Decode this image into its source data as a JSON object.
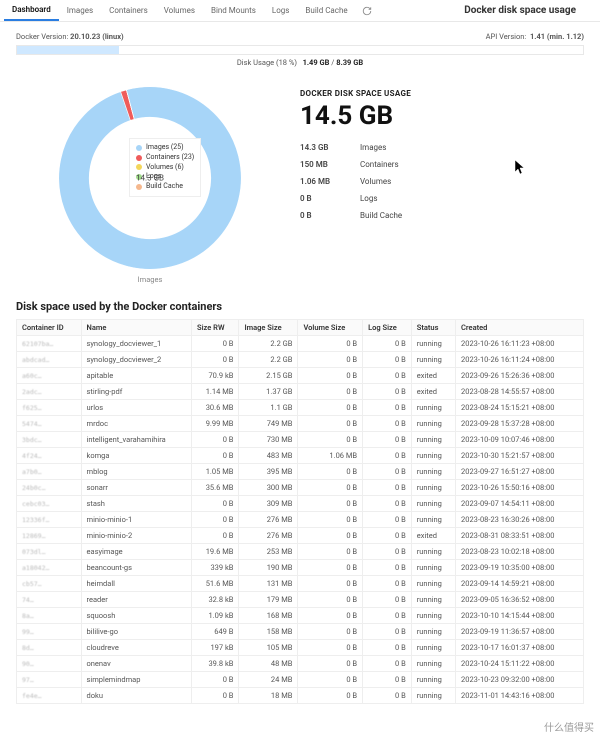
{
  "tabs": [
    "Dashboard",
    "Images",
    "Containers",
    "Volumes",
    "Bind Mounts",
    "Logs",
    "Build Cache"
  ],
  "active_tab": 0,
  "title": "Docker disk space usage",
  "docker_version_label": "Docker Version:",
  "docker_version": "20.10.23 (linux)",
  "api_version_label": "API Version:",
  "api_version": "1.41 (min. 1.12)",
  "usage_bar": {
    "percent": 18,
    "text_prefix": "Disk Usage (18 %)",
    "used": "1.49 GB",
    "total": "8.39 GB"
  },
  "colors": {
    "images": "#a7d5f8",
    "containers": "#ef5b5b",
    "volumes": "#f3d65b",
    "logs": "#9fd98a",
    "buildcache": "#f5b88e"
  },
  "legend": [
    {
      "key": "images",
      "label": "Images (25)"
    },
    {
      "key": "containers",
      "label": "Containers (23)"
    },
    {
      "key": "volumes",
      "label": "Volumes (6)"
    },
    {
      "key": "logs",
      "label": "Logs"
    },
    {
      "key": "buildcache",
      "label": "Build Cache"
    }
  ],
  "donut_center": "14.3 GB",
  "donut_caption": "Images",
  "stats_heading": "DOCKER DISK SPACE USAGE",
  "total": "14.5 GB",
  "stats": [
    {
      "val": "14.3 GB",
      "label": "Images"
    },
    {
      "val": "150 MB",
      "label": "Containers"
    },
    {
      "val": "1.06 MB",
      "label": "Volumes"
    },
    {
      "val": "0 B",
      "label": "Logs"
    },
    {
      "val": "0 B",
      "label": "Build Cache"
    }
  ],
  "table_title": "Disk space used by the Docker containers",
  "columns": [
    "Container ID",
    "Name",
    "Size RW",
    "Image Size",
    "Volume Size",
    "Log Size",
    "Status",
    "Created"
  ],
  "rows": [
    {
      "cid": "62107ba…",
      "name": "synology_docviewer_1",
      "rw": "0 B",
      "img": "2.2 GB",
      "vol": "0 B",
      "log": "0 B",
      "status": "running",
      "created": "2023-10-26 16:11:23 +08:00"
    },
    {
      "cid": "abdcad…",
      "name": "synology_docviewer_2",
      "rw": "0 B",
      "img": "2.2 GB",
      "vol": "0 B",
      "log": "0 B",
      "status": "running",
      "created": "2023-10-26 16:11:24 +08:00"
    },
    {
      "cid": "a60c…",
      "name": "apitable",
      "rw": "70.9 kB",
      "img": "2.15 GB",
      "vol": "0 B",
      "log": "0 B",
      "status": "exited",
      "created": "2023-09-26 15:26:36 +08:00"
    },
    {
      "cid": "2adc…",
      "name": "stirling-pdf",
      "rw": "1.14 MB",
      "img": "1.37 GB",
      "vol": "0 B",
      "log": "0 B",
      "status": "exited",
      "created": "2023-08-28 14:55:57 +08:00"
    },
    {
      "cid": "f625…",
      "name": "urlos",
      "rw": "30.6 MB",
      "img": "1.1 GB",
      "vol": "0 B",
      "log": "0 B",
      "status": "running",
      "created": "2023-08-24 15:15:21 +08:00"
    },
    {
      "cid": "5474…",
      "name": "mrdoc",
      "rw": "9.99 MB",
      "img": "749 MB",
      "vol": "0 B",
      "log": "0 B",
      "status": "running",
      "created": "2023-09-28 15:37:28 +08:00"
    },
    {
      "cid": "3bdc…",
      "name": "intelligent_varahamihira",
      "rw": "0 B",
      "img": "730 MB",
      "vol": "0 B",
      "log": "0 B",
      "status": "running",
      "created": "2023-10-09 10:07:46 +08:00"
    },
    {
      "cid": "4f24…",
      "name": "komga",
      "rw": "0 B",
      "img": "483 MB",
      "vol": "1.06 MB",
      "log": "0 B",
      "status": "running",
      "created": "2023-10-30 15:21:57 +08:00"
    },
    {
      "cid": "a7b0…",
      "name": "mblog",
      "rw": "1.05 MB",
      "img": "395 MB",
      "vol": "0 B",
      "log": "0 B",
      "status": "running",
      "created": "2023-09-27 16:51:27 +08:00"
    },
    {
      "cid": "24b0c…",
      "name": "sonarr",
      "rw": "35.6 MB",
      "img": "300 MB",
      "vol": "0 B",
      "log": "0 B",
      "status": "running",
      "created": "2023-10-26 15:50:16 +08:00"
    },
    {
      "cid": "cebc03…",
      "name": "stash",
      "rw": "0 B",
      "img": "309 MB",
      "vol": "0 B",
      "log": "0 B",
      "status": "running",
      "created": "2023-09-07 14:54:11 +08:00"
    },
    {
      "cid": "12336f…",
      "name": "minio-minio-1",
      "rw": "0 B",
      "img": "276 MB",
      "vol": "0 B",
      "log": "0 B",
      "status": "running",
      "created": "2023-08-23 16:30:26 +08:00"
    },
    {
      "cid": "12869…",
      "name": "minio-minio-2",
      "rw": "0 B",
      "img": "276 MB",
      "vol": "0 B",
      "log": "0 B",
      "status": "exited",
      "created": "2023-08-31 08:33:51 +08:00"
    },
    {
      "cid": "073dl…",
      "name": "easyimage",
      "rw": "19.6 MB",
      "img": "253 MB",
      "vol": "0 B",
      "log": "0 B",
      "status": "running",
      "created": "2023-08-23 10:02:18 +08:00"
    },
    {
      "cid": "a18042…",
      "name": "beancount-gs",
      "rw": "339 kB",
      "img": "190 MB",
      "vol": "0 B",
      "log": "0 B",
      "status": "running",
      "created": "2023-09-19 10:35:00 +08:00"
    },
    {
      "cid": "cb57…",
      "name": "heimdall",
      "rw": "51.6 MB",
      "img": "131 MB",
      "vol": "0 B",
      "log": "0 B",
      "status": "running",
      "created": "2023-09-14 14:59:21 +08:00"
    },
    {
      "cid": "74…",
      "name": "reader",
      "rw": "32.8 kB",
      "img": "179 MB",
      "vol": "0 B",
      "log": "0 B",
      "status": "running",
      "created": "2023-09-05 16:36:52 +08:00"
    },
    {
      "cid": "8a…",
      "name": "squoosh",
      "rw": "1.09 kB",
      "img": "168 MB",
      "vol": "0 B",
      "log": "0 B",
      "status": "running",
      "created": "2023-10-10 14:15:44 +08:00"
    },
    {
      "cid": "99…",
      "name": "bililive-go",
      "rw": "649 B",
      "img": "158 MB",
      "vol": "0 B",
      "log": "0 B",
      "status": "running",
      "created": "2023-09-19 11:36:57 +08:00"
    },
    {
      "cid": "8d…",
      "name": "cloudreve",
      "rw": "197 kB",
      "img": "105 MB",
      "vol": "0 B",
      "log": "0 B",
      "status": "running",
      "created": "2023-10-17 16:01:37 +08:00"
    },
    {
      "cid": "90…",
      "name": "onenav",
      "rw": "39.8 kB",
      "img": "48 MB",
      "vol": "0 B",
      "log": "0 B",
      "status": "running",
      "created": "2023-10-24 15:11:22 +08:00"
    },
    {
      "cid": "97…",
      "name": "simplemindmap",
      "rw": "0 B",
      "img": "24 MB",
      "vol": "0 B",
      "log": "0 B",
      "status": "running",
      "created": "2023-10-23 09:32:00 +08:00"
    },
    {
      "cid": "fe4e…",
      "name": "doku",
      "rw": "0 B",
      "img": "18 MB",
      "vol": "0 B",
      "log": "0 B",
      "status": "running",
      "created": "2023-11-01 14:43:16 +08:00"
    }
  ],
  "chart_data": {
    "type": "pie",
    "title": "Docker disk space usage",
    "unit": "GB",
    "series": [
      {
        "name": "Images (25)",
        "value": 14.3,
        "color_key": "images"
      },
      {
        "name": "Containers (23)",
        "value": 0.15,
        "color_key": "containers"
      },
      {
        "name": "Volumes (6)",
        "value": 0.00106,
        "color_key": "volumes"
      },
      {
        "name": "Logs",
        "value": 0,
        "color_key": "logs"
      },
      {
        "name": "Build Cache",
        "value": 0,
        "color_key": "buildcache"
      }
    ],
    "total_label": "14.5 GB"
  },
  "watermark": "什么值得买"
}
